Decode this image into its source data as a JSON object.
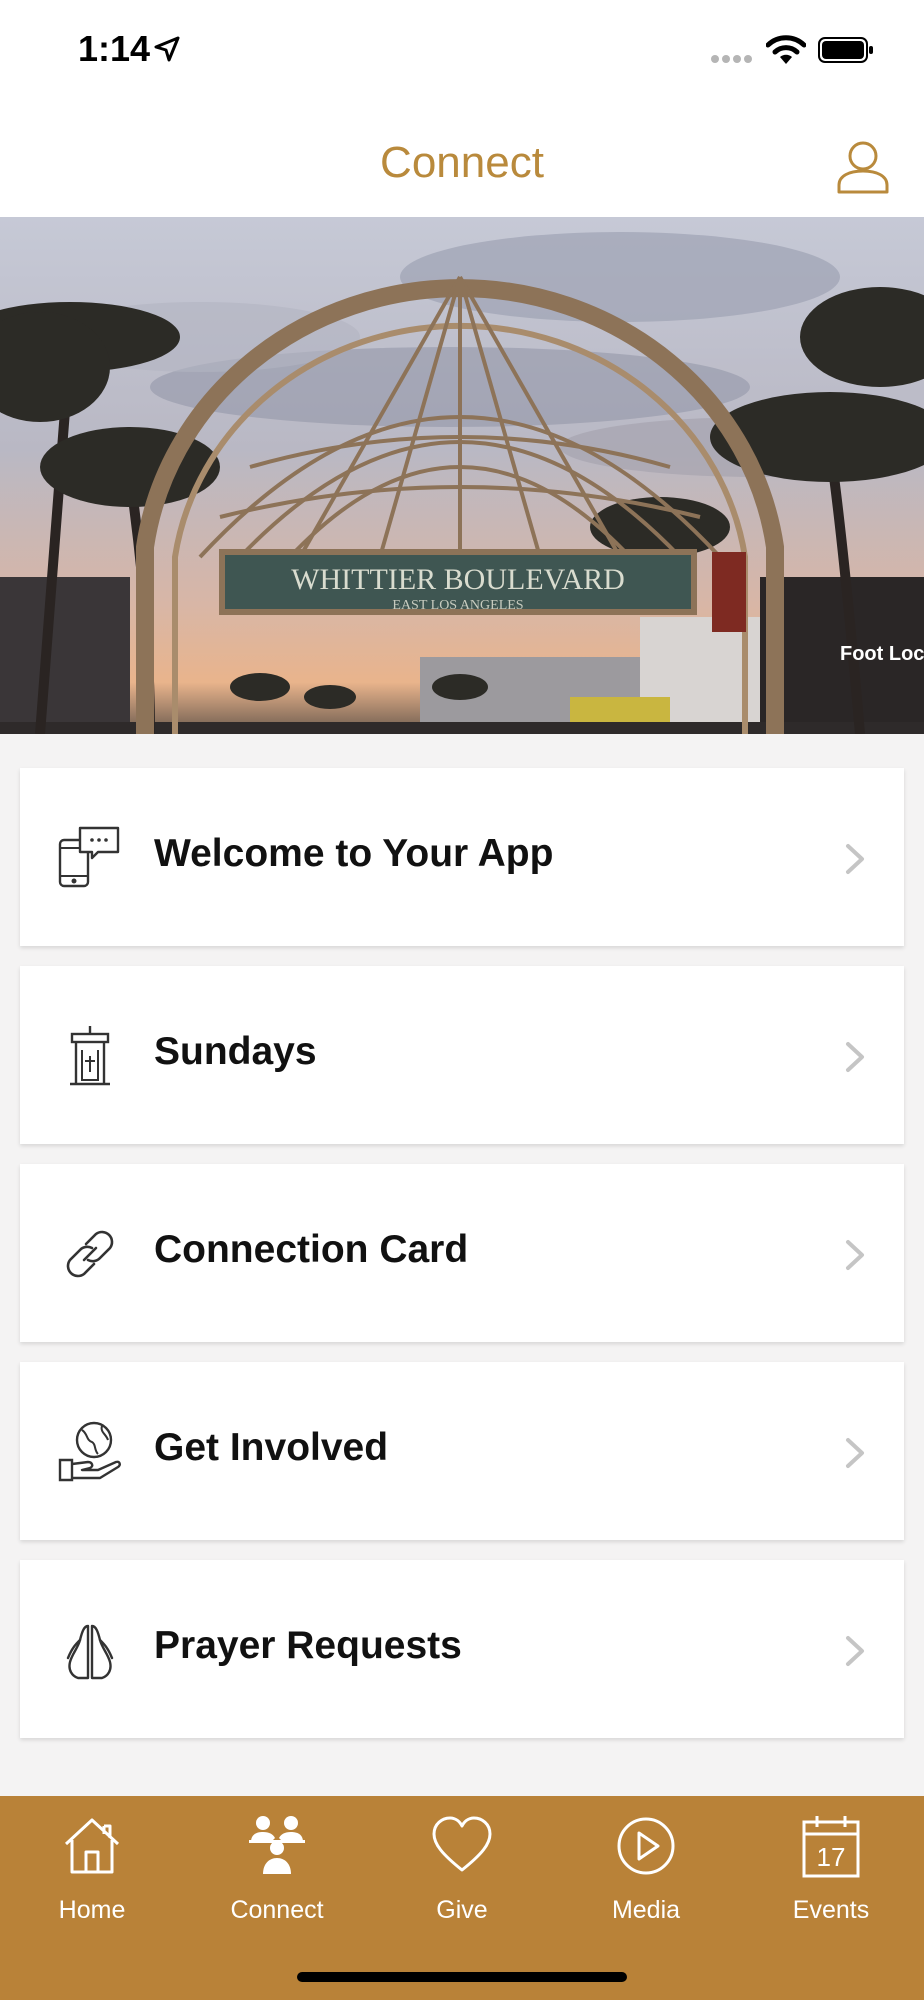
{
  "status_bar": {
    "time": "1:14"
  },
  "header": {
    "title": "Connect"
  },
  "hero": {
    "sign_text": "WHITTIER BOULEVARD",
    "sign_subtext": "EAST LOS ANGELES",
    "store_text": "Foot Locke"
  },
  "menu": {
    "items": [
      {
        "label": "Welcome to Your App",
        "icon": "phone-chat-icon"
      },
      {
        "label": "Sundays",
        "icon": "pulpit-icon"
      },
      {
        "label": "Connection Card",
        "icon": "link-icon"
      },
      {
        "label": "Get Involved",
        "icon": "globe-hand-icon"
      },
      {
        "label": "Prayer Requests",
        "icon": "praying-hands-icon"
      }
    ]
  },
  "tab_bar": {
    "tabs": [
      {
        "label": "Home",
        "icon": "home-icon"
      },
      {
        "label": "Connect",
        "icon": "people-icon"
      },
      {
        "label": "Give",
        "icon": "heart-icon"
      },
      {
        "label": "Media",
        "icon": "play-icon"
      },
      {
        "label": "Events",
        "icon": "calendar-icon",
        "calendar_day": "17"
      }
    ]
  },
  "colors": {
    "accent": "#b98a3c",
    "tab_bar_bg": "#b98238",
    "background": "#f4f3f3"
  }
}
